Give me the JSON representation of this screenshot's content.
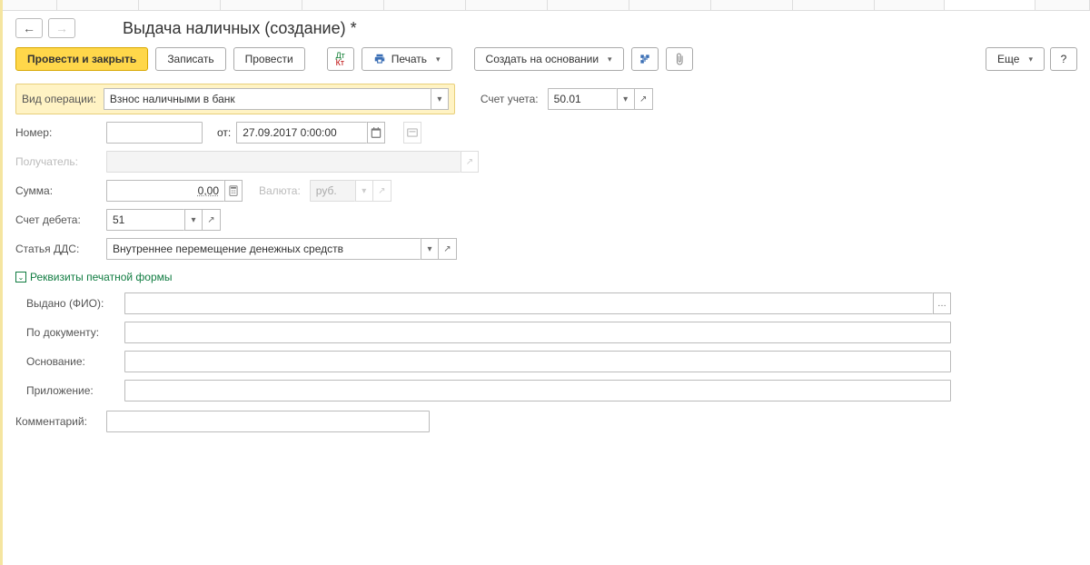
{
  "header": {
    "title": "Выдача наличных (создание) *"
  },
  "toolbar": {
    "post_close": "Провести и закрыть",
    "save": "Записать",
    "post": "Провести",
    "print": "Печать",
    "create_based": "Создать на основании",
    "more": "Еще"
  },
  "labels": {
    "op_type": "Вид операции:",
    "account": "Счет учета:",
    "number": "Номер:",
    "from": "от:",
    "recipient": "Получатель:",
    "sum": "Сумма:",
    "currency": "Валюта:",
    "debit_acc": "Счет дебета:",
    "dds": "Статья ДДС:",
    "print_req": "Реквизиты печатной формы",
    "issued_to": "Выдано (ФИО):",
    "by_document": "По документу:",
    "basis": "Основание:",
    "attachment": "Приложение:",
    "comment": "Комментарий:"
  },
  "values": {
    "op_type": "Взнос наличными в банк",
    "account": "50.01",
    "number": "",
    "date": "27.09.2017  0:00:00",
    "recipient": "",
    "sum": "0,00",
    "currency": "руб.",
    "debit_acc": "51",
    "dds": "Внутреннее перемещение денежных средств",
    "issued_to": "",
    "by_document": "",
    "basis": "",
    "attachment": "",
    "comment": ""
  }
}
